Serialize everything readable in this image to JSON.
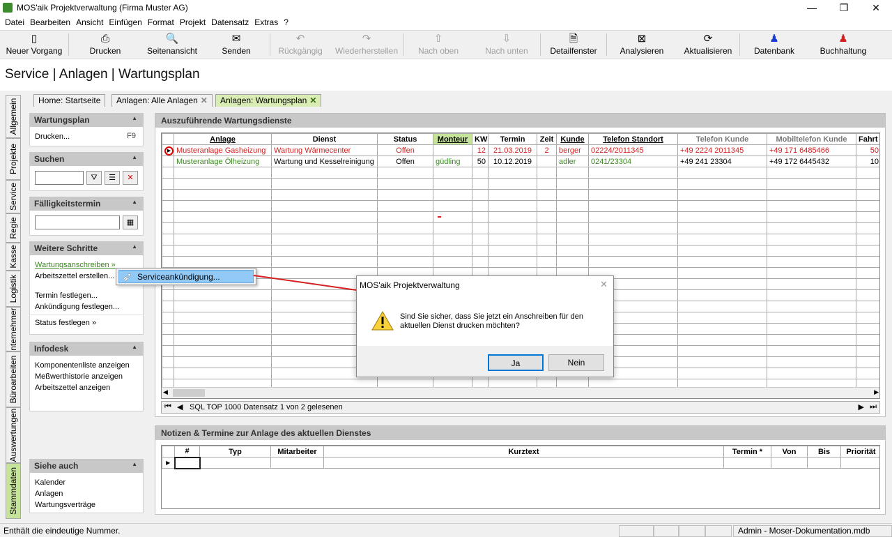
{
  "window": {
    "title": "MOS'aik Projektverwaltung (Firma Muster AG)"
  },
  "menu": [
    "Datei",
    "Bearbeiten",
    "Ansicht",
    "Einfügen",
    "Format",
    "Projekt",
    "Datensatz",
    "Extras",
    "?"
  ],
  "toolbar": [
    {
      "label": "Neuer Vorgang",
      "icon": "new-doc-icon",
      "glyph": "▯",
      "enabled": true
    },
    {
      "label": "Drucken",
      "icon": "printer-icon",
      "glyph": "⎙",
      "enabled": true
    },
    {
      "label": "Seitenansicht",
      "icon": "preview-icon",
      "glyph": "🔍",
      "enabled": true
    },
    {
      "label": "Senden",
      "icon": "mail-icon",
      "glyph": "✉",
      "enabled": true
    },
    {
      "label": "Rückgängig",
      "icon": "undo-icon",
      "glyph": "↶",
      "enabled": false
    },
    {
      "label": "Wiederherstellen",
      "icon": "redo-icon",
      "glyph": "↷",
      "enabled": false
    },
    {
      "label": "Nach oben",
      "icon": "arrow-up-icon",
      "glyph": "⇧",
      "enabled": false
    },
    {
      "label": "Nach unten",
      "icon": "arrow-down-icon",
      "glyph": "⇩",
      "enabled": false
    },
    {
      "label": "Detailfenster",
      "icon": "detail-window-icon",
      "glyph": "🗎",
      "enabled": true
    },
    {
      "label": "Analysieren",
      "icon": "excel-icon",
      "glyph": "⊠",
      "enabled": true
    },
    {
      "label": "Aktualisieren",
      "icon": "refresh-icon",
      "glyph": "⟳",
      "enabled": true
    },
    {
      "label": "Datenbank",
      "icon": "database-user-icon",
      "glyph": "♟",
      "enabled": true
    },
    {
      "label": "Buchhaltung",
      "icon": "accounting-user-icon",
      "glyph": "♟",
      "enabled": true
    }
  ],
  "page": {
    "title": "Service | Anlagen | Wartungsplan"
  },
  "vtabs": [
    "Allgemein",
    "Projekte",
    "Service",
    "Regie",
    "Kasse",
    "Logistik",
    "nternehmer",
    "Büroarbeiten",
    "Auswertungen",
    "Stammdaten"
  ],
  "doctabs": [
    {
      "label": "Home: Startseite"
    },
    {
      "label": "Anlagen: Alle Anlagen",
      "close": "✕"
    },
    {
      "label": "Anlagen: Wartungsplan",
      "close": "✕"
    }
  ],
  "left": {
    "wartungsplan": {
      "title": "Wartungsplan",
      "print_label": "Drucken...",
      "print_key": "F9"
    },
    "suchen": {
      "title": "Suchen",
      "value": ""
    },
    "faellig": {
      "title": "Fälligkeitstermin",
      "value": ""
    },
    "weitere": {
      "title": "Weitere Schritte",
      "links": [
        "Wartungsanschreiben »",
        "Arbeitszettel erstellen...",
        "Termin festlegen...",
        "Ankündigung festlegen...",
        "Status festlegen »"
      ]
    },
    "infodesk": {
      "title": "Infodesk",
      "links": [
        "Komponentenliste anzeigen",
        "Meßwerthistorie anzeigen",
        "Arbeitszettel anzeigen"
      ]
    },
    "siehe": {
      "title": "Siehe auch",
      "links": [
        "Kalender",
        "Anlagen",
        "Wartungsverträge"
      ]
    }
  },
  "context_menu": {
    "item": "Serviceankündigung..."
  },
  "main": {
    "title": "Auszuführende Wartungsdienste",
    "columns": [
      "Anlage",
      "Dienst",
      "Status",
      "Monteur",
      "KW",
      "Termin",
      "Zeit",
      "Kunde",
      "Telefon Standort",
      "Telefon Kunde",
      "Mobiltelefon Kunde",
      "Fahrt"
    ],
    "rows": [
      [
        "Musteranlage Gasheizung",
        "Wartung Wärmecenter",
        "Offen",
        "",
        "12",
        "21.03.2019",
        "2",
        "berger",
        "02224/2011345",
        "+49 2224 2011345",
        "+49 171 6485466",
        "50"
      ],
      [
        "Musteranlage Ölheizung",
        "Wartung und Kesselreinigung",
        "Offen",
        "güdling",
        "50",
        "10.12.2019",
        "",
        "adler",
        "0241/23304",
        "+49 241 23304",
        "+49 172 6445432",
        "10"
      ]
    ],
    "nav_text": "SQL TOP 1000 Datensatz 1 von 2 gelesenen"
  },
  "notes": {
    "title": "Notizen & Termine zur Anlage des aktuellen Dienstes",
    "columns": [
      "#",
      "Typ",
      "Mitarbeiter",
      "Kurztext",
      "Termin *",
      "Von",
      "Bis",
      "Priorität"
    ]
  },
  "dialog": {
    "title": "MOS'aik Projektverwaltung",
    "message": "Sind Sie sicher, dass Sie jetzt ein Anschreiben für den aktuellen Dienst drucken möchten?",
    "yes": "Ja",
    "no": "Nein",
    "close": "✕"
  },
  "status": {
    "left": "Enthält die eindeutige Nummer.",
    "right": "Admin - Moser-Dokumentation.mdb"
  },
  "colors": {
    "accent_green": "#c6e39a",
    "red_row": "#d42020",
    "green_row": "#3a8a1f"
  }
}
